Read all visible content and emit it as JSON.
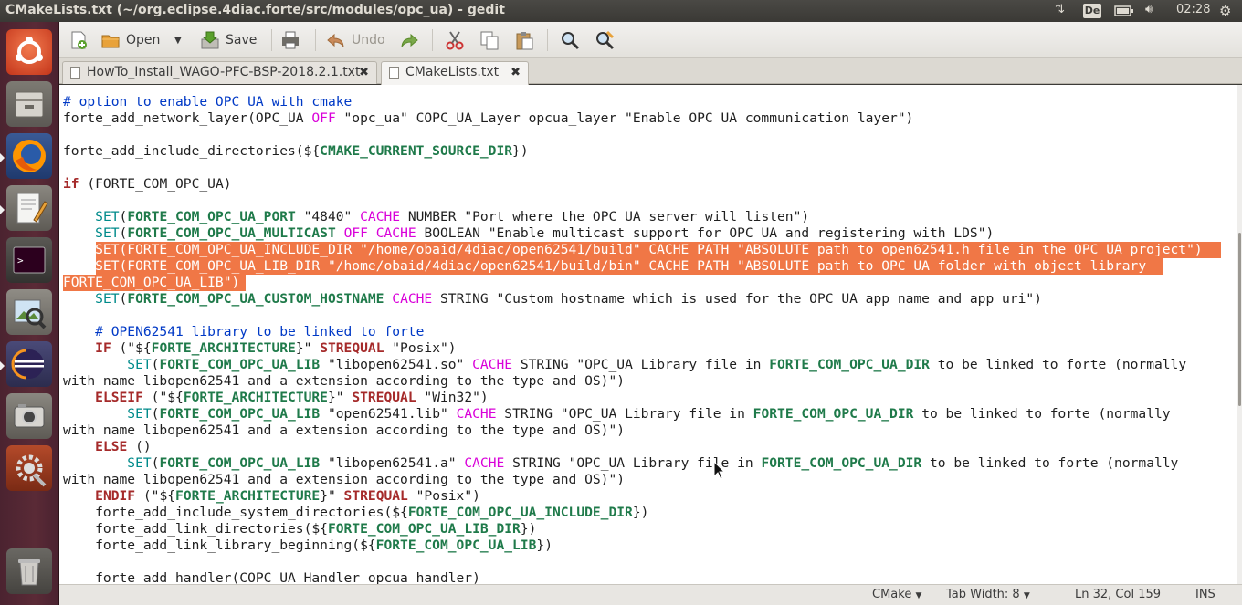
{
  "window": {
    "title": "CMakeLists.txt (~/org.eclipse.4diac.forte/src/modules/opc_ua) - gedit"
  },
  "indicators": {
    "keyboard_layout": "De",
    "clock": "02:28"
  },
  "launcher": {
    "items": [
      {
        "name": "ubuntu-dash-icon"
      },
      {
        "name": "files-icon"
      },
      {
        "name": "firefox-icon"
      },
      {
        "name": "text-editor-icon"
      },
      {
        "name": "terminal-icon"
      },
      {
        "name": "image-viewer-icon"
      },
      {
        "name": "eclipse-icon"
      },
      {
        "name": "camera-icon"
      },
      {
        "name": "system-settings-icon"
      },
      {
        "name": "trash-icon"
      }
    ]
  },
  "toolbar": {
    "open_label": "Open",
    "save_label": "Save",
    "undo_label": "Undo"
  },
  "tabs": [
    {
      "label": "HowTo_Install_WAGO-PFC-BSP-2018.2.1.txt",
      "close": "✖"
    },
    {
      "label": "CMakeLists.txt",
      "close": "✖"
    }
  ],
  "status": {
    "language": "CMake",
    "tab_width": "Tab Width: 8",
    "position": "Ln 32, Col 159",
    "mode": "INS"
  },
  "code_lines": [
    "# option to enable OPC UA with cmake",
    "forte_add_network_layer(OPC_UA OFF \"opc_ua\" COPC_UA_Layer opcua_layer \"Enable OPC UA communication layer\")",
    "",
    "forte_add_include_directories(${CMAKE_CURRENT_SOURCE_DIR})",
    "",
    "if (FORTE_COM_OPC_UA)",
    "",
    "    SET(FORTE_COM_OPC_UA_PORT \"4840\" CACHE NUMBER \"Port where the OPC_UA server will listen\")",
    "    SET(FORTE_COM_OPC_UA_MULTICAST OFF CACHE BOOLEAN \"Enable multicast support for OPC UA and registering with LDS\")",
    "    SET(FORTE_COM_OPC_UA_INCLUDE_DIR \"/home/obaid/4diac/open62541/build\" CACHE PATH \"ABSOLUTE path to open62541.h file in the OPC UA project\")",
    "    SET(FORTE_COM_OPC_UA_LIB_DIR \"/home/obaid/4diac/open62541/build/bin\" CACHE PATH \"ABSOLUTE path to OPC UA folder with object library",
    "FORTE_COM_OPC_UA_LIB\")",
    "    SET(FORTE_COM_OPC_UA_CUSTOM_HOSTNAME CACHE STRING \"Custom hostname which is used for the OPC UA app name and app uri\")",
    "",
    "    # OPEN62541 library to be linked to forte",
    "    IF (\"${FORTE_ARCHITECTURE}\" STREQUAL \"Posix\")",
    "        SET(FORTE_COM_OPC_UA_LIB \"libopen62541.so\" CACHE STRING \"OPC_UA Library file in FORTE_COM_OPC_UA_DIR to be linked to forte (normally",
    "with name libopen62541 and a extension according to the type and OS)\")",
    "    ELSEIF (\"${FORTE_ARCHITECTURE}\" STREQUAL \"Win32\")",
    "        SET(FORTE_COM_OPC_UA_LIB \"open62541.lib\" CACHE STRING \"OPC_UA Library file in FORTE_COM_OPC_UA_DIR to be linked to forte (normally",
    "with name libopen62541 and a extension according to the type and OS)\")",
    "    ELSE ()",
    "        SET(FORTE_COM_OPC_UA_LIB \"libopen62541.a\" CACHE STRING \"OPC_UA Library file in FORTE_COM_OPC_UA_DIR to be linked to forte (normally",
    "with name libopen62541 and a extension according to the type and OS)\")",
    "    ENDIF (\"${FORTE_ARCHITECTURE}\" STREQUAL \"Posix\")",
    "    forte_add_include_system_directories(${FORTE_COM_OPC_UA_INCLUDE_DIR})",
    "    forte_add_link_directories(${FORTE_COM_OPC_UA_LIB_DIR})",
    "    forte_add_link_library_beginning(${FORTE_COM_OPC_UA_LIB})",
    "",
    "    forte_add_handler(COPC_UA_Handler opcua_handler)"
  ],
  "selected_lines": [
    9,
    10,
    11
  ],
  "colors": {
    "selection": "#f07746",
    "launcher": "#5a2a36",
    "comment": "#0039c6",
    "keyword": "#a52a2a",
    "function": "#008b8b",
    "variable": "#1f7a4a",
    "constant": "#d900d9"
  }
}
